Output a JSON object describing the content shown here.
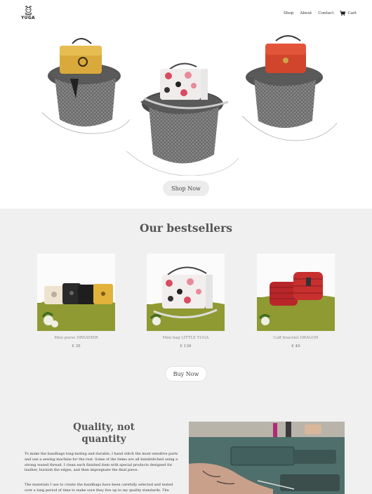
{
  "header": {
    "logo_text": "YUGA",
    "nav": [
      "Shop",
      "About",
      "Contact"
    ],
    "cart_label": "Cart"
  },
  "hero": {
    "cta_label": "Shop Now"
  },
  "bestsellers": {
    "title": "Our bestsellers",
    "products": [
      {
        "name": "Mini purse DREAMER",
        "price": "€ 35"
      },
      {
        "name": "Mini bag LITTLE YUGA",
        "price": "€ 139"
      },
      {
        "name": "Cuff bracelet DRAGON",
        "price": "€ 45"
      }
    ],
    "cta_label": "Buy Now"
  },
  "quality": {
    "title": "Quality, not quantity",
    "paragraph1": "To make the handbags long-lasting and durable, I hand stitch the most sensitive parts and use a sewing machine for the rest. Some of the items are all handstitched using a strong waxed thread. I clean each finished item with special products designed for leather, burnish the edges, and then impregnate the final piece.",
    "paragraph2": "The materials I use to create the handbags have been carefully selected and tested over a long period of time to make sure they live up to my quality standards. The"
  },
  "colors": {
    "section_bg": "#f0f0f0",
    "button_bg": "#ececec",
    "text": "#444444"
  }
}
